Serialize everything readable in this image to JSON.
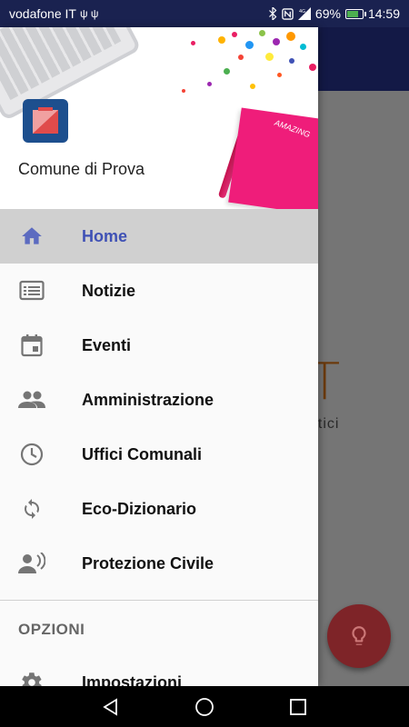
{
  "status_bar": {
    "carrier": "vodafone IT",
    "usb_icons": "ψ ψ",
    "battery_percent": "69%",
    "time": "14:59",
    "battery_level": 0.69
  },
  "app": {
    "name": "Comune di Prova",
    "background_logo_fragment": "T",
    "background_subtext_fragment": "atici"
  },
  "menu": {
    "items": [
      {
        "label": "Home",
        "icon": "home-icon",
        "active": true
      },
      {
        "label": "Notizie",
        "icon": "news-icon",
        "active": false
      },
      {
        "label": "Eventi",
        "icon": "calendar-icon",
        "active": false
      },
      {
        "label": "Amministrazione",
        "icon": "people-icon",
        "active": false
      },
      {
        "label": "Uffici Comunali",
        "icon": "clock-icon",
        "active": false
      },
      {
        "label": "Eco-Dizionario",
        "icon": "sync-icon",
        "active": false
      },
      {
        "label": "Protezione Civile",
        "icon": "speaker-person-icon",
        "active": false
      }
    ],
    "options_title": "OPZIONI",
    "options_items": [
      {
        "label": "Impostazioni",
        "icon": "settings-icon"
      }
    ]
  },
  "notebook_text": "AMAZING",
  "colors": {
    "accent": "#3f51b5",
    "status_bar": "#1a2250",
    "icon_grey": "#757575",
    "fab": "#7e2428"
  }
}
